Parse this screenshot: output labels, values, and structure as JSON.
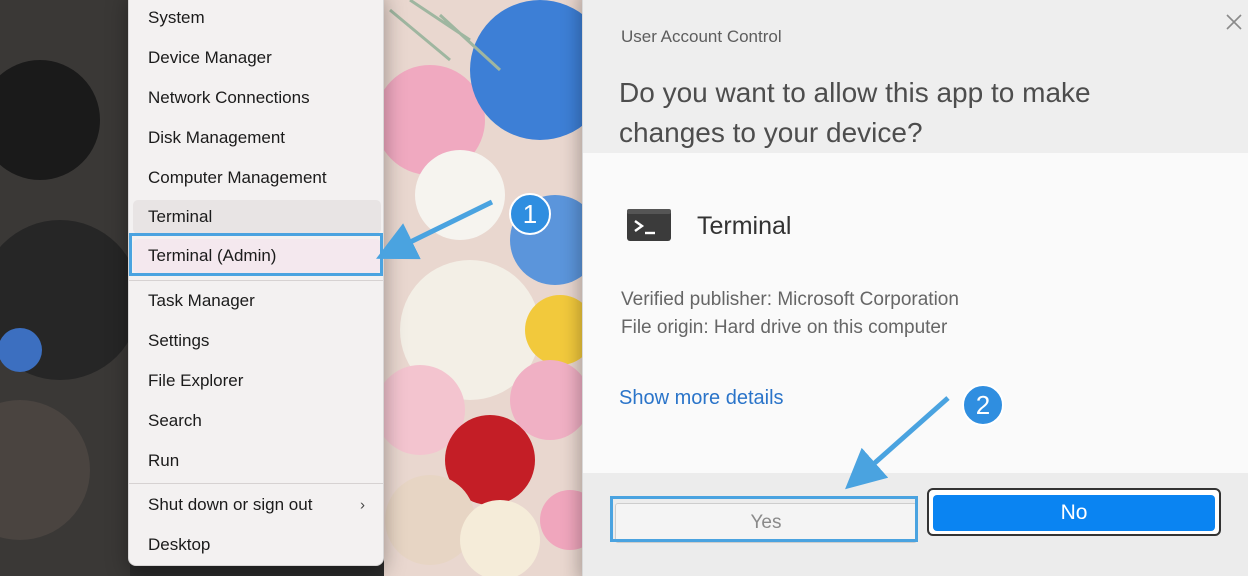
{
  "menu": {
    "items": [
      {
        "label": "System"
      },
      {
        "label": "Device Manager"
      },
      {
        "label": "Network Connections"
      },
      {
        "label": "Disk Management"
      },
      {
        "label": "Computer Management"
      },
      {
        "label": "Terminal"
      },
      {
        "label": "Terminal (Admin)"
      },
      {
        "label": "Task Manager"
      },
      {
        "label": "Settings"
      },
      {
        "label": "File Explorer"
      },
      {
        "label": "Search"
      },
      {
        "label": "Run"
      },
      {
        "label": "Shut down or sign out"
      },
      {
        "label": "Desktop"
      }
    ],
    "submenu_chevron": "›"
  },
  "uac": {
    "title": "User Account Control",
    "question": "Do you want to allow this app to make changes to your device?",
    "app_name": "Terminal",
    "publisher": "Verified publisher: Microsoft Corporation",
    "origin": "File origin: Hard drive on this computer",
    "more_details": "Show more details",
    "yes_label": "Yes",
    "no_label": "No"
  },
  "annotations": {
    "step1": "1",
    "step2": "2"
  },
  "colors": {
    "accent": "#0a84f2",
    "annotation_blue": "#4aa3e0",
    "link": "#2a74c9"
  },
  "icons": [
    "terminal-app-icon",
    "close-icon",
    "chevron-right-icon",
    "arrow-annotation-icon"
  ]
}
